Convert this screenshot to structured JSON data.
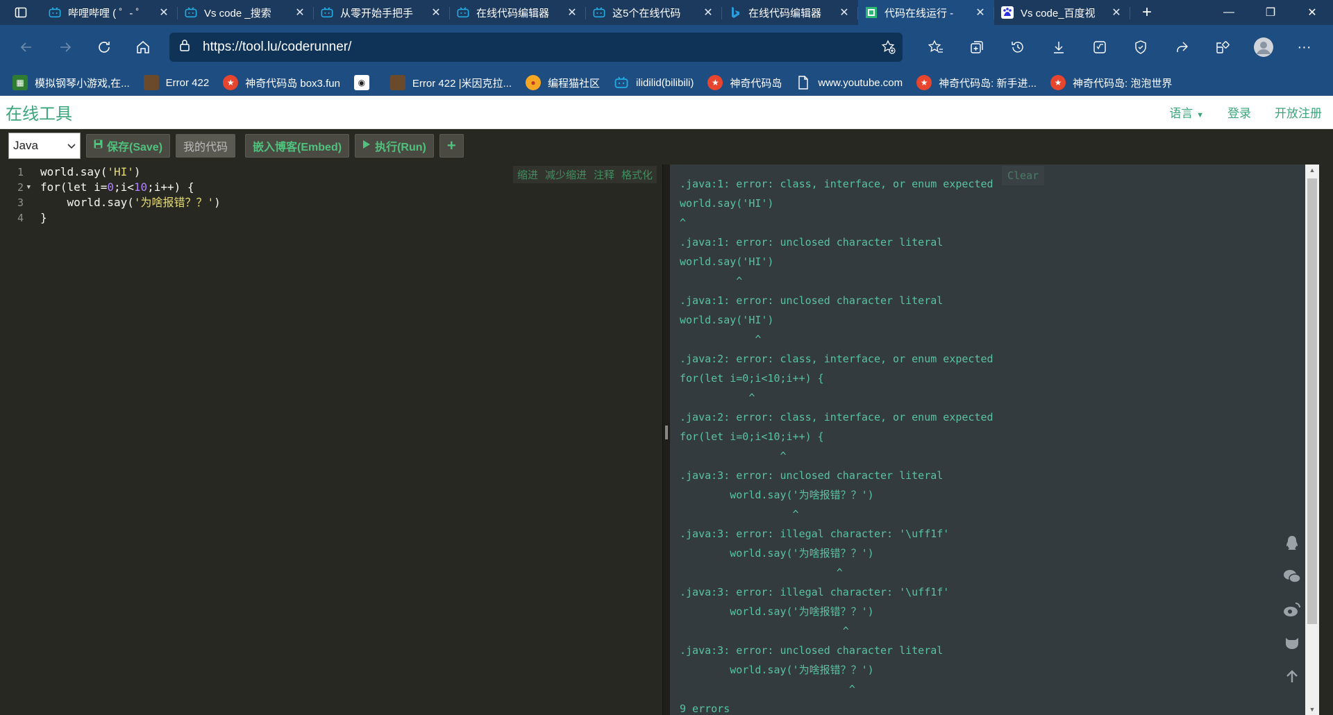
{
  "browser": {
    "tabs": [
      {
        "title": "哔哩哔哩 ( ゜- ゜",
        "icon": "bilibili-icon"
      },
      {
        "title": "Vs code _搜索",
        "icon": "bilibili-icon"
      },
      {
        "title": "从零开始手把手",
        "icon": "bilibili-icon"
      },
      {
        "title": "在线代码编辑器",
        "icon": "bilibili-icon"
      },
      {
        "title": "这5个在线代码",
        "icon": "bilibili-icon"
      },
      {
        "title": "在线代码编辑器",
        "icon": "bing-icon"
      },
      {
        "title": "代码在线运行 -",
        "icon": "toollu-icon",
        "active": true
      },
      {
        "title": "Vs code_百度视",
        "icon": "baidu-icon"
      }
    ],
    "address": "https://tool.lu/coderunner/",
    "bookmarks": [
      "模拟钢琴小游戏,在...",
      "Error 422",
      "神奇代码岛 box3.fun",
      "",
      "Error 422 |米因克拉...",
      "编程猫社区",
      "ilidilid(bilibili)",
      "神奇代码岛",
      "www.youtube.com",
      "神奇代码岛: 新手进...",
      "神奇代码岛: 泡泡世界"
    ]
  },
  "site": {
    "brand": "在线工具",
    "nav": {
      "language": "语言",
      "login": "登录",
      "register": "开放注册"
    }
  },
  "controls": {
    "language": "Java",
    "save": "保存(Save)",
    "my_code": "我的代码",
    "embed": "嵌入博客(Embed)",
    "run": "执行(Run)",
    "add": "+"
  },
  "editor": {
    "tools": [
      "缩进",
      "减少缩进",
      "注释",
      "格式化"
    ],
    "lines": [
      "1",
      "2",
      "3",
      "4"
    ]
  },
  "output": {
    "clear": "Clear",
    "text": ".java:1: error: class, interface, or enum expected\nworld.say('HI')\n^\n.java:1: error: unclosed character literal\nworld.say('HI')\n         ^\n.java:1: error: unclosed character literal\nworld.say('HI')\n            ^\n.java:2: error: class, interface, or enum expected\nfor(let i=0;i<10;i++) {\n           ^\n.java:2: error: class, interface, or enum expected\nfor(let i=0;i<10;i++) {\n                ^\n.java:3: error: unclosed character literal\n        world.say('为啥报错？？')\n                  ^\n.java:3: error: illegal character: '\\uff1f'\n        world.say('为啥报错？？')\n                         ^\n.java:3: error: illegal character: '\\uff1f'\n        world.say('为啥报错？？')\n                          ^\n.java:3: error: unclosed character literal\n        world.say('为啥报错？？')\n                           ^\n9 errors"
  }
}
